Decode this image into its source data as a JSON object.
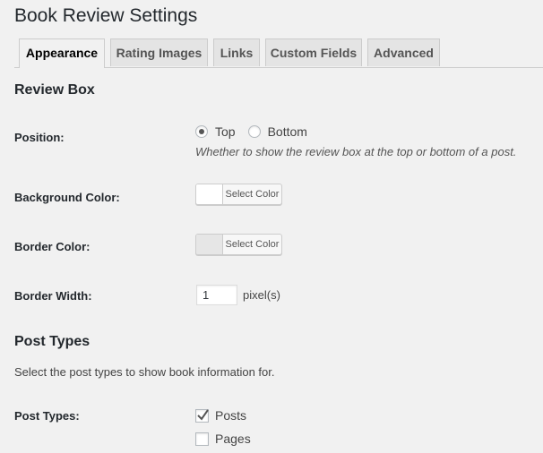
{
  "page": {
    "title": "Book Review Settings"
  },
  "tabs": [
    {
      "label": "Appearance",
      "active": true
    },
    {
      "label": "Rating Images",
      "active": false
    },
    {
      "label": "Links",
      "active": false
    },
    {
      "label": "Custom Fields",
      "active": false
    },
    {
      "label": "Advanced",
      "active": false
    }
  ],
  "review_box": {
    "heading": "Review Box",
    "position": {
      "label": "Position:",
      "options": [
        {
          "label": "Top",
          "checked": true
        },
        {
          "label": "Bottom",
          "checked": false
        }
      ],
      "description": "Whether to show the review box at the top or bottom of a post."
    },
    "background_color": {
      "label": "Background Color:",
      "button": "Select Color",
      "swatch": "#ffffff"
    },
    "border_color": {
      "label": "Border Color:",
      "button": "Select Color",
      "swatch": "#e6e6e6"
    },
    "border_width": {
      "label": "Border Width:",
      "value": "1",
      "unit": "pixel(s)"
    }
  },
  "post_types": {
    "heading": "Post Types",
    "intro": "Select the post types to show book information for.",
    "label": "Post Types:",
    "options": [
      {
        "label": "Posts",
        "checked": true
      },
      {
        "label": "Pages",
        "checked": false
      }
    ]
  }
}
